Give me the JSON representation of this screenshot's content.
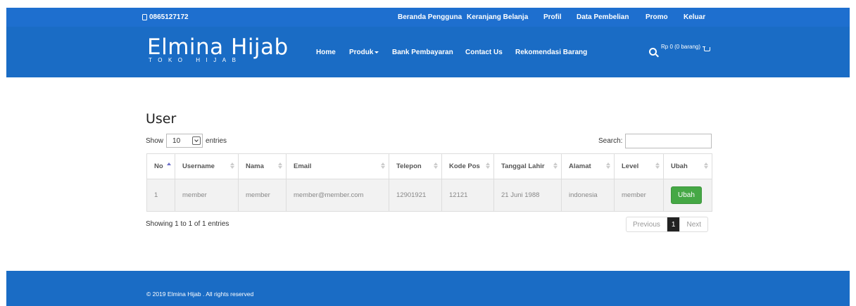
{
  "topbar": {
    "phone": "0865127172",
    "links": [
      "Beranda Pengguna",
      "Keranjang Belanja",
      "Profil",
      "Data Pembelian",
      "Promo",
      "Keluar"
    ]
  },
  "header": {
    "brand_name": "Elmina Hijab",
    "brand_tagline": "TOKO HIJAB",
    "nav": [
      "Home",
      "Produk",
      "Bank Pembayaran",
      "Contact Us",
      "Rekomendasi Barang"
    ],
    "cart_text": "Rp 0 (0 barang)"
  },
  "main": {
    "title": "User",
    "length_prefix": "Show",
    "length_value": "10",
    "length_suffix": "entries",
    "search_label": "Search:",
    "columns": [
      "No",
      "Username",
      "Nama",
      "Email",
      "Telepon",
      "Kode Pos",
      "Tanggal Lahir",
      "Alamat",
      "Level",
      "Ubah"
    ],
    "rows": [
      [
        "1",
        "member",
        "member",
        "member@member.com",
        "12901921",
        "12121",
        "21 Juni 1988",
        "indonesia",
        "member"
      ]
    ],
    "edit_label": "Ubah",
    "info": "Showing 1 to 1 of 1 entries",
    "pagination": {
      "previous": "Previous",
      "page": "1",
      "next": "Next"
    }
  },
  "footer": {
    "copyright": "© 2019 Elmina Hijab . All rights reserved"
  },
  "colors": {
    "topbar": "#1e6fcf",
    "header": "#1a6cc5",
    "button_green": "#45a845"
  }
}
